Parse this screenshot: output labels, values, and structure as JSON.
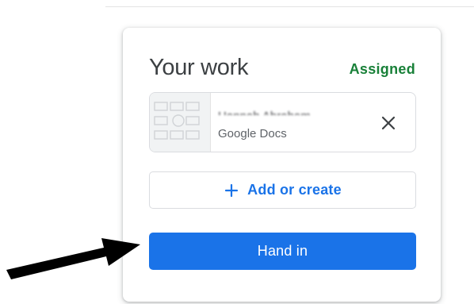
{
  "your_work": {
    "title": "Your work",
    "status": "Assigned",
    "attachment": {
      "name": "Hannah Abraham ...",
      "type": "Google Docs"
    },
    "add_or_create_label": "Add or create",
    "hand_in_label": "Hand in"
  },
  "icons": {
    "remove": "close-icon",
    "add": "plus-icon",
    "annotation": "arrow-icon"
  },
  "colors": {
    "accent": "#1a73e8",
    "status": "#188038",
    "text": "#3c4043",
    "secondary_text": "#5f6368",
    "border": "#dadce0",
    "arrow": "#000000"
  }
}
